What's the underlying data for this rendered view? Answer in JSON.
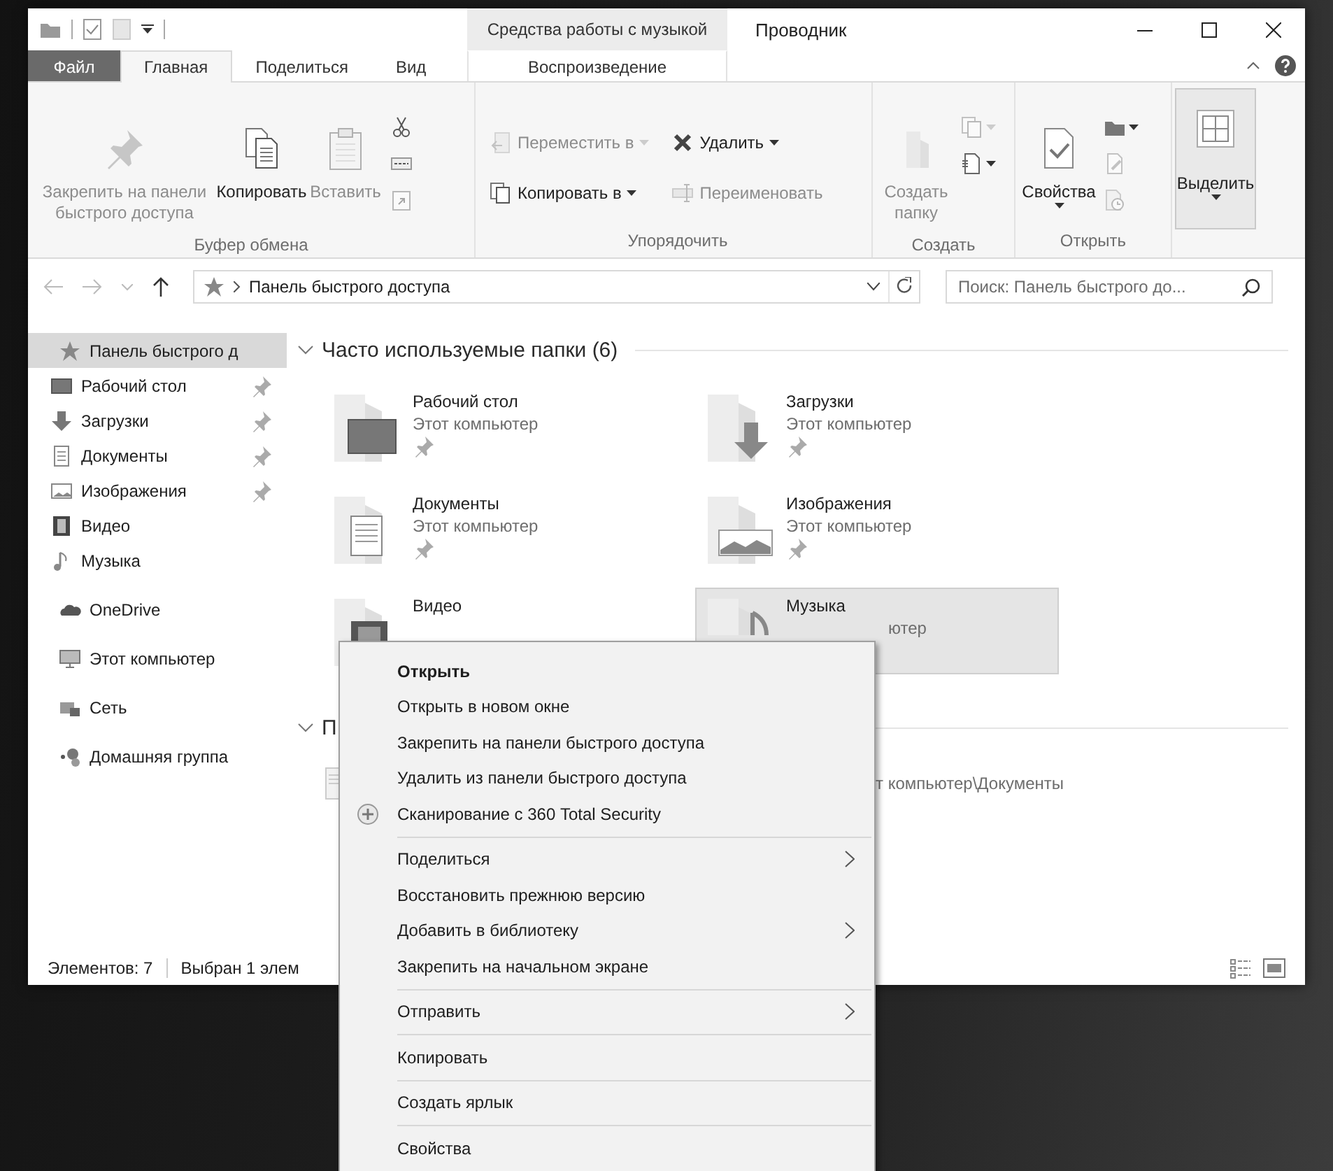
{
  "title_bar": {
    "context_group": "Средства работы с музыкой",
    "title": "Проводник"
  },
  "tabs": [
    {
      "label": "Файл",
      "kind": "file",
      "selected": false
    },
    {
      "label": "Главная",
      "kind": "tab",
      "selected": true
    },
    {
      "label": "Поделиться",
      "kind": "tab",
      "selected": false
    },
    {
      "label": "Вид",
      "kind": "tab",
      "selected": false
    },
    {
      "label": "Воспроизведение",
      "kind": "contextual",
      "selected": false
    }
  ],
  "ribbon": {
    "groups": [
      {
        "label": "Буфер обмена",
        "columns": [
          {
            "buttons": [
              {
                "kind": "large",
                "label": "Закрепить на панели быстрого доступа",
                "disabled": true,
                "dropdown": false,
                "pressed": false
              }
            ]
          },
          {
            "buttons": [
              {
                "kind": "large",
                "label": "Копировать",
                "disabled": false,
                "dropdown": false,
                "pressed": false
              }
            ]
          },
          {
            "buttons": [
              {
                "kind": "large",
                "label": "Вставить",
                "disabled": true,
                "dropdown": false,
                "pressed": false
              }
            ]
          },
          {
            "buttons": [
              {
                "kind": "icon",
                "disabled": false,
                "dropdown": false,
                "pressed": false
              },
              {
                "kind": "icon",
                "disabled": false,
                "dropdown": false,
                "pressed": false
              },
              {
                "kind": "icon",
                "disabled": true,
                "dropdown": false,
                "pressed": false
              }
            ]
          }
        ]
      },
      {
        "label": "Упорядочить",
        "columns": [
          {
            "buttons": [
              {
                "kind": "small",
                "label": "Переместить в",
                "disabled": true,
                "dropdown": true,
                "pressed": false
              },
              {
                "kind": "small",
                "label": "Копировать в",
                "disabled": false,
                "dropdown": true,
                "pressed": false
              }
            ]
          },
          {
            "buttons": [
              {
                "kind": "small",
                "label": "Удалить",
                "disabled": false,
                "dropdown": true,
                "pressed": false
              },
              {
                "kind": "small",
                "label": "Переименовать",
                "disabled": true,
                "dropdown": false,
                "pressed": false
              }
            ]
          }
        ]
      },
      {
        "label": "Создать",
        "columns": [
          {
            "buttons": [
              {
                "kind": "large",
                "label": "Создать папку",
                "disabled": true,
                "dropdown": false,
                "pressed": false
              }
            ]
          },
          {
            "buttons": [
              {
                "kind": "icon",
                "disabled": true,
                "dropdown": true,
                "pressed": false
              },
              {
                "kind": "icon",
                "disabled": false,
                "dropdown": true,
                "pressed": false
              }
            ]
          }
        ]
      },
      {
        "label": "Открыть",
        "columns": [
          {
            "buttons": [
              {
                "kind": "large",
                "label": "Свойства",
                "disabled": false,
                "dropdown": true,
                "pressed": false
              }
            ]
          },
          {
            "buttons": [
              {
                "kind": "icon",
                "disabled": false,
                "dropdown": true,
                "pressed": false
              },
              {
                "kind": "icon",
                "disabled": true,
                "dropdown": false,
                "pressed": false
              },
              {
                "kind": "icon",
                "disabled": true,
                "dropdown": false,
                "pressed": false
              }
            ]
          }
        ]
      },
      {
        "columns": [
          {
            "buttons": [
              {
                "kind": "large",
                "label": "Выделить",
                "disabled": false,
                "dropdown": true,
                "pressed": true
              }
            ]
          }
        ]
      }
    ]
  },
  "address": {
    "path": "Панель быстрого доступа",
    "search_placeholder": "Поиск: Панель быстрого до..."
  },
  "navigation": [
    {
      "label": "Панель быстрого д",
      "selected": true,
      "pinned": false,
      "children": [
        {
          "label": "Рабочий стол",
          "selected": false,
          "pinned": true
        },
        {
          "label": "Загрузки",
          "selected": false,
          "pinned": true
        },
        {
          "label": "Документы",
          "selected": false,
          "pinned": true
        },
        {
          "label": "Изображения",
          "selected": false,
          "pinned": true
        },
        {
          "label": "Видео",
          "selected": false,
          "pinned": false
        },
        {
          "label": "Музыка",
          "selected": false,
          "pinned": false
        }
      ]
    },
    {
      "label": "OneDrive",
      "selected": false,
      "pinned": false
    },
    {
      "label": "Этот компьютер",
      "selected": false,
      "pinned": false
    },
    {
      "label": "Сеть",
      "selected": false,
      "pinned": false
    },
    {
      "label": "Домашняя группа",
      "selected": false,
      "pinned": false
    }
  ],
  "sections": [
    {
      "title": "Часто используемые папки (6)",
      "expanded": true,
      "kind": "tiles",
      "items": [
        {
          "name": "Рабочий стол",
          "location": "Этот компьютер",
          "pinned": true,
          "selected": false
        },
        {
          "name": "Загрузки",
          "location": "Этот компьютер",
          "pinned": true,
          "selected": false
        },
        {
          "name": "Документы",
          "location": "Этот компьютер",
          "pinned": true,
          "selected": false
        },
        {
          "name": "Изображения",
          "location": "Этот компьютер",
          "pinned": true,
          "selected": false
        },
        {
          "name": "Видео",
          "pinned": false,
          "selected": false
        },
        {
          "name": "Музыка",
          "location": "ютер",
          "pinned": false,
          "selected": true
        }
      ]
    },
    {
      "title": "П",
      "expanded": true,
      "kind": "list",
      "items": [
        {
          "location": "т компьютер\\Документы"
        }
      ]
    }
  ],
  "status_bar": {
    "item_count": "Элементов: 7",
    "selection": "Выбран 1 элем"
  },
  "context_menu": [
    {
      "kind": "item",
      "label": "Открыть",
      "default": true,
      "submenu": false
    },
    {
      "kind": "item",
      "label": "Открыть в новом окне",
      "default": false,
      "submenu": false
    },
    {
      "kind": "item",
      "label": "Закрепить на панели быстрого доступа",
      "default": false,
      "submenu": false
    },
    {
      "kind": "item",
      "label": "Удалить из панели быстрого доступа",
      "default": false,
      "submenu": false
    },
    {
      "kind": "icon_item",
      "label": "Сканирование с 360 Total Security",
      "default": false,
      "submenu": false
    },
    {
      "kind": "separator"
    },
    {
      "kind": "item",
      "label": "Поделиться",
      "default": false,
      "submenu": true
    },
    {
      "kind": "item",
      "label": "Восстановить прежнюю версию",
      "default": false,
      "submenu": false
    },
    {
      "kind": "item",
      "label": "Добавить в библиотеку",
      "default": false,
      "submenu": true
    },
    {
      "kind": "item",
      "label": "Закрепить на начальном экране",
      "default": false,
      "submenu": false
    },
    {
      "kind": "separator"
    },
    {
      "kind": "item",
      "label": "Отправить",
      "default": false,
      "submenu": true
    },
    {
      "kind": "separator"
    },
    {
      "kind": "item",
      "label": "Копировать",
      "default": false,
      "submenu": false
    },
    {
      "kind": "separator"
    },
    {
      "kind": "item",
      "label": "Создать ярлык",
      "default": false,
      "submenu": false
    },
    {
      "kind": "separator"
    },
    {
      "kind": "item",
      "label": "Свойства",
      "default": false,
      "submenu": false
    }
  ]
}
